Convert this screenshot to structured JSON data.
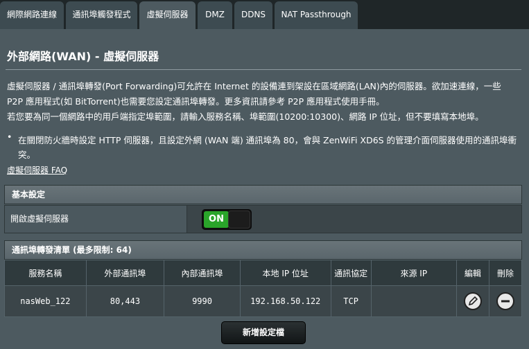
{
  "tabs": [
    {
      "label": "網際網路連線"
    },
    {
      "label": "通訊埠觸發程式"
    },
    {
      "label": "虛擬伺服器"
    },
    {
      "label": "DMZ"
    },
    {
      "label": "DDNS"
    },
    {
      "label": "NAT Passthrough"
    }
  ],
  "active_tab": "虛擬伺服器",
  "page": {
    "title": "外部網路(WAN) - 虛擬伺服器",
    "desc_line1": "虛擬伺服器 / 通訊埠轉發(Port Forwarding)可允許在 Internet 的設備連到架設在區域網路(LAN)內的伺服器。欲加速連線，一些",
    "desc_line2": "P2P 應用程式(如 BitTorrent)也需要您設定通訊埠轉發。更多資訊請參考 P2P 應用程式使用手冊。",
    "desc_line3": "若您要為同一個網路中的用戶端指定埠範圍，請輸入服務名稱、埠範圍(10200:10300)、網路 IP 位址，但不要填寫本地埠。",
    "bullet": "•",
    "note_line1": "在關閉防火牆時設定 HTTP 伺服器，且設定外網 (WAN 端) 通訊埠為 80，會與 ZenWiFi XD6S 的管理介面伺服器使用的通訊埠衝",
    "note_line2": "突。",
    "faq_link": "虛擬伺服器 FAQ"
  },
  "basic": {
    "header": "基本設定",
    "enable_label": "開啟虛擬伺服器",
    "toggle_state": "ON"
  },
  "list": {
    "header": "通訊埠轉發清單 (最多限制: 64)",
    "columns": [
      "服務名稱",
      "外部通訊埠",
      "內部通訊埠",
      "本地 IP 位址",
      "通訊協定",
      "來源 IP",
      "編輯",
      "刪除"
    ],
    "rows": [
      {
        "service": "nasWeb_122",
        "external_port": "80,443",
        "internal_port": "9990",
        "local_ip": "192.168.50.122",
        "protocol": "TCP",
        "source_ip": ""
      }
    ]
  },
  "add_button": "新增設定檔",
  "colors": {
    "panel": "#4d5a60",
    "tab": "#3d4b51",
    "toggle_on": "#2aa52a"
  }
}
